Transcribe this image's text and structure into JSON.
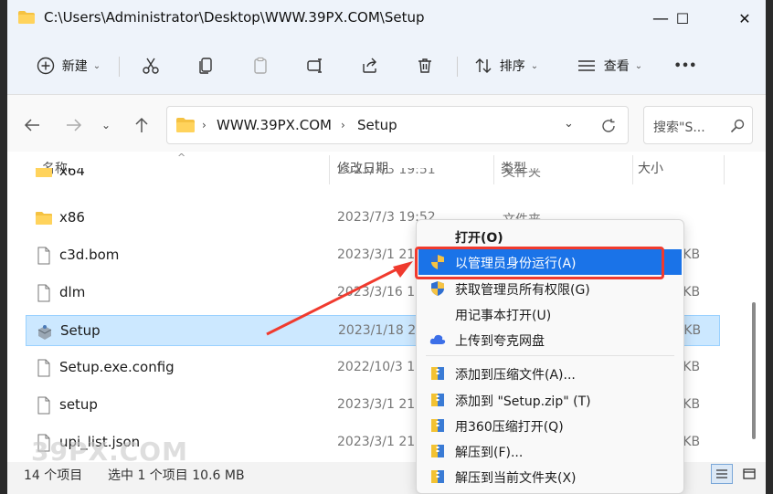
{
  "window": {
    "title": "C:\\Users\\Administrator\\Desktop\\WWW.39PX.COM\\Setup",
    "minimize": "—",
    "maximize": "☐",
    "close": "✕"
  },
  "toolbar": {
    "new_label": "新建",
    "sort_label": "排序",
    "view_label": "查看",
    "more_label": "•••"
  },
  "address": {
    "seg1": "WWW.39PX.COM",
    "seg2": "Setup",
    "search_placeholder": "搜索\"S..."
  },
  "columns": {
    "name": "名称",
    "date": "修改日期",
    "type": "类型",
    "size": "大小"
  },
  "files": [
    {
      "name": "x64",
      "date": "2023/7/3 19:51",
      "type": "文件夹",
      "size": "",
      "icon": "folder-icon"
    },
    {
      "name": "x86",
      "date": "2023/7/3 19:52",
      "type": "文件夹",
      "size": "",
      "icon": "folder-icon"
    },
    {
      "name": "c3d.bom",
      "date": "2023/3/1 21",
      "type": "",
      "size": "1 KB",
      "icon": "file-icon"
    },
    {
      "name": "dlm",
      "date": "2023/3/16 1",
      "type": "",
      "size": "1 KB",
      "icon": "file-icon"
    },
    {
      "name": "Setup",
      "date": "2023/1/18 2",
      "type": "",
      "size": "6 KB",
      "icon": "setup-icon"
    },
    {
      "name": "Setup.exe.config",
      "date": "2022/10/3 1",
      "type": "",
      "size": "0 KB",
      "icon": "file-icon"
    },
    {
      "name": "setup",
      "date": "2023/3/1 21",
      "type": "",
      "size": "8 KB",
      "icon": "file-icon"
    },
    {
      "name": "upi_list.json",
      "date": "2023/3/1 21",
      "type": "",
      "size": "3 KB",
      "icon": "file-icon"
    }
  ],
  "status": {
    "count": "14 个项目",
    "selected": "选中 1 个项目 10.6 MB"
  },
  "context_menu": {
    "items": [
      {
        "label": "打开(O)",
        "icon": ""
      },
      {
        "label": "以管理员身份运行(A)",
        "icon": "shield-icon"
      },
      {
        "label": "获取管理员所有权限(G)",
        "icon": "shield-icon"
      },
      {
        "label": "用记事本打开(U)",
        "icon": ""
      },
      {
        "label": "上传到夸克网盘",
        "icon": "cloud-icon"
      },
      {
        "label": "添加到压缩文件(A)...",
        "icon": "archive-icon"
      },
      {
        "label": "添加到 \"Setup.zip\" (T)",
        "icon": "archive-icon"
      },
      {
        "label": "用360压缩打开(Q)",
        "icon": "archive-icon"
      },
      {
        "label": "解压到(F)...",
        "icon": "archive-icon"
      },
      {
        "label": "解压到当前文件夹(X)",
        "icon": "archive-icon"
      }
    ]
  },
  "watermark": "39PX.COM",
  "colors": {
    "accent": "#1a73e8",
    "highlight_box": "#f03a2e",
    "selection": "#cce8ff"
  }
}
